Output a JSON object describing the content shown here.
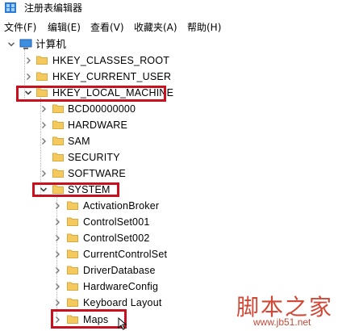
{
  "window": {
    "title": "注册表编辑器",
    "icon": "regedit-icon"
  },
  "menu": [
    "文件(F)",
    "编辑(E)",
    "查看(V)",
    "收藏夹(A)",
    "帮助(H)"
  ],
  "tree": {
    "root": "计算机",
    "hives": [
      "HKEY_CLASSES_ROOT",
      "HKEY_CURRENT_USER",
      "HKEY_LOCAL_MACHINE"
    ],
    "hklm_children": [
      "BCD00000000",
      "HARDWARE",
      "SAM",
      "SECURITY",
      "SOFTWARE",
      "SYSTEM"
    ],
    "system_children": [
      "ActivationBroker",
      "ControlSet001",
      "ControlSet002",
      "CurrentControlSet",
      "DriverDatabase",
      "HardwareConfig",
      "Keyboard Layout",
      "Maps"
    ]
  },
  "watermark": {
    "text": "脚本之家",
    "url": "www.jb51.net"
  },
  "colors": {
    "highlight": "#c8101e",
    "folder": "#f4c95d",
    "watermark": "#d24836"
  }
}
